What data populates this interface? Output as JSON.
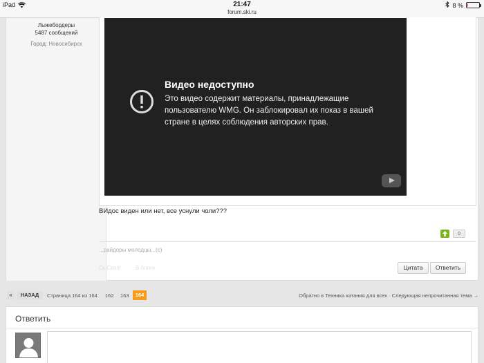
{
  "status_bar": {
    "device": "iPad",
    "time": "21:47",
    "url": "forum.ski.ru",
    "battery": "8 %",
    "battery_level": 0.08,
    "icons": [
      "wifi-icon",
      "bluetooth-icon",
      "battery-icon"
    ]
  },
  "author": {
    "group": "Лыжебордеры",
    "messages": "5487 сообщений",
    "city_label": "Город:",
    "city": "Новосибирск"
  },
  "video": {
    "title": "Видео недоступно",
    "message": "Это видео содержит материалы, принадлежащие пользователю WMG. Он заблокировал их показ в вашей стране в целях соблюдения авторских прав."
  },
  "post": {
    "text": "ВИдос виден или нет, все уснули чоли???",
    "votes": "0",
    "signature": "...райдоры молодцы...(с)",
    "faded_1": "СыСтоп!",
    "faded_2": "В блоге"
  },
  "actions": {
    "quote": "Цитата",
    "reply": "Ответить"
  },
  "pagination": {
    "first": "«",
    "back": "НАЗАД",
    "info": "Страница 164 из 164",
    "pages": [
      "162",
      "163"
    ],
    "current": "164",
    "back_to_forum": "Обратно в Техника катания для всех",
    "separator": "·",
    "next_unread": "Следующая непрочитанная тема →"
  },
  "reply_form": {
    "title": "Ответить"
  },
  "colors": {
    "accent": "#f89b1c",
    "vote_up": "#7ab51d",
    "video_bg": "#212121"
  }
}
